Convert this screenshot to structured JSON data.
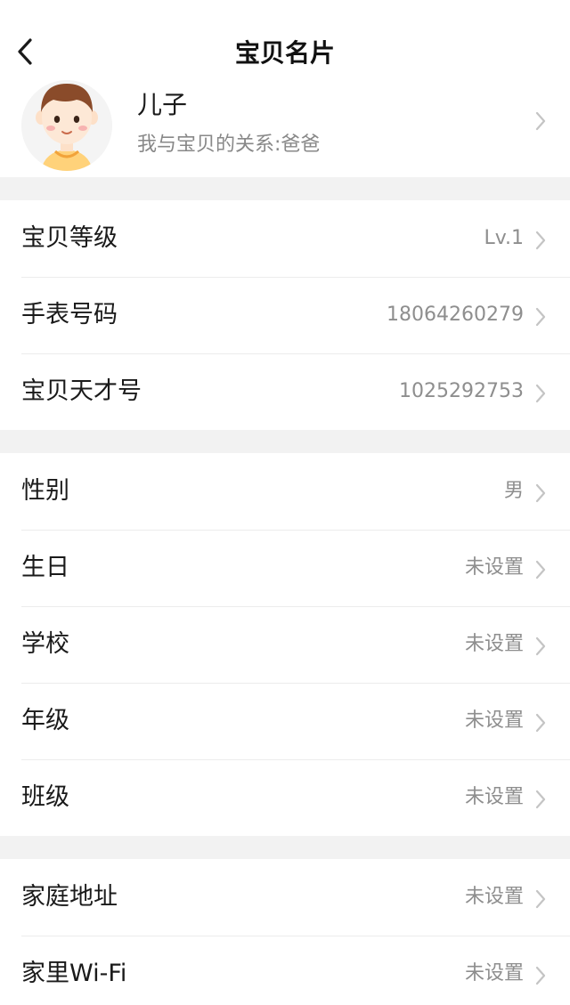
{
  "header": {
    "title": "宝贝名片",
    "back_icon": "chevron-left-icon"
  },
  "profile": {
    "name": "儿子",
    "relation": "我与宝贝的关系:爸爸",
    "avatar_icon": "boy-avatar-icon"
  },
  "group1": {
    "items": [
      {
        "label": "宝贝等级",
        "value": "Lv.1"
      },
      {
        "label": "手表号码",
        "value": "18064260279"
      },
      {
        "label": "宝贝天才号",
        "value": "1025292753"
      }
    ]
  },
  "group2": {
    "items": [
      {
        "label": "性别",
        "value": "男"
      },
      {
        "label": "生日",
        "value": "未设置"
      },
      {
        "label": "学校",
        "value": "未设置"
      },
      {
        "label": "年级",
        "value": "未设置"
      },
      {
        "label": "班级",
        "value": "未设置"
      }
    ]
  },
  "group3": {
    "items": [
      {
        "label": "家庭地址",
        "value": "未设置"
      },
      {
        "label": "家里Wi-Fi",
        "value": "未设置"
      }
    ]
  },
  "colors": {
    "background": "#f2f2f2",
    "card": "#ffffff",
    "primary_text": "#1a1a1a",
    "secondary_text": "#8e8e8e",
    "chevron": "#c4c4c4"
  }
}
